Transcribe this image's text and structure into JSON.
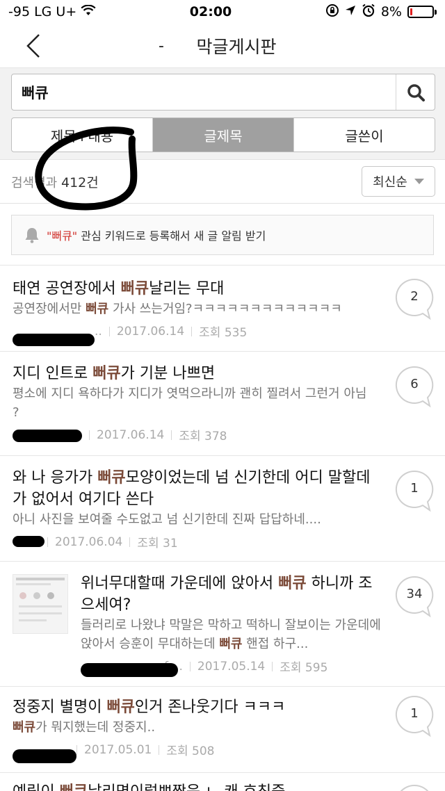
{
  "status_bar": {
    "carrier": "-95 LG U+",
    "time": "02:00",
    "battery": "8%",
    "battery_level": 0.08,
    "icons": [
      "wifi-icon",
      "rotation-lock-icon",
      "location-icon",
      "alarm-icon"
    ]
  },
  "nav": {
    "back_icon": "chevron-left-icon",
    "dash": "-",
    "title": "막글게시판"
  },
  "search": {
    "value": "뻐큐",
    "icon": "search-icon"
  },
  "segments": [
    {
      "label": "제목+내용",
      "active": false
    },
    {
      "label": "글제목",
      "active": true
    },
    {
      "label": "글쓴이",
      "active": false
    }
  ],
  "result": {
    "label": "검색결과",
    "count": "412건",
    "sort_label": "최신순"
  },
  "alert": {
    "icon": "bell-icon",
    "keyword": "\"뻐큐\"",
    "text": " 관심 키워드로 등록해서 새 글 알림 받기"
  },
  "posts": [
    {
      "title_pre": "태연 공연장에서 ",
      "title_hl": "뻐큐",
      "title_post": "날리는 무대",
      "excerpt_pre": "공연장에서만 ",
      "excerpt_hl": "뻐큐",
      "excerpt_post": " 가사 쓰는거임?ㅋㅋㅋㅋㅋㅋㅋㅋㅋㅋㅋㅋㅋ",
      "author": "..",
      "date": "2017.06.14",
      "views": "조회 535",
      "comments": "2"
    },
    {
      "title_pre": "지디 인트로 ",
      "title_hl": "뻐큐",
      "title_post": "가 기분 나쁘면",
      "excerpt_pre": "평소에 지디 욕하다가 지디가 엿먹으라니까 괜히 찔려서 그런거 아님 ?",
      "excerpt_hl": "",
      "excerpt_post": "",
      "author": "",
      "date": "2017.06.14",
      "views": "조회 378",
      "comments": "6"
    },
    {
      "title_pre": "와 나 응가가 ",
      "title_hl": "뻐큐",
      "title_post": "모양이었는데 넘 신기한데 어디 말할데가 없어서 여기다 쓴다",
      "excerpt_pre": "아니 사진을 보여줄 수도없고 넘 신기한데 진짜 답답하네....",
      "excerpt_hl": "",
      "excerpt_post": "",
      "author": "",
      "date": "2017.06.04",
      "views": "조회 31",
      "comments": "1"
    },
    {
      "title_pre": "위너무대할때 가운데에 앉아서 ",
      "title_hl": "뻐큐",
      "title_post": " 하니까 조으세여?",
      "excerpt_pre": "들러리로 나왔냐 막말은 막하고 떡하니 잘보이는 가운데에 앉아서 승훈이 무대하는데 ",
      "excerpt_hl": "뻐큐",
      "excerpt_post": " 핸접 하구...",
      "author": "fo..",
      "date": "2017.05.14",
      "views": "조회 595",
      "comments": "34"
    },
    {
      "title_pre": "정중지 별명이 ",
      "title_hl": "뻐큐",
      "title_post": "인거 존나웃기다 ㅋㅋㅋ",
      "excerpt_pre": "",
      "excerpt_hl": "뻐큐",
      "excerpt_post": "가 뭐지했는데 정중지..",
      "author": "",
      "date": "2017.05.01",
      "views": "조회 508",
      "comments": "1"
    }
  ],
  "partial_post": {
    "title_pre": "예림이 ",
    "title_hl": "뻐큐",
    "title_post": "날리면이렇쁘짱음 ㄴ 캐 호칭중"
  }
}
